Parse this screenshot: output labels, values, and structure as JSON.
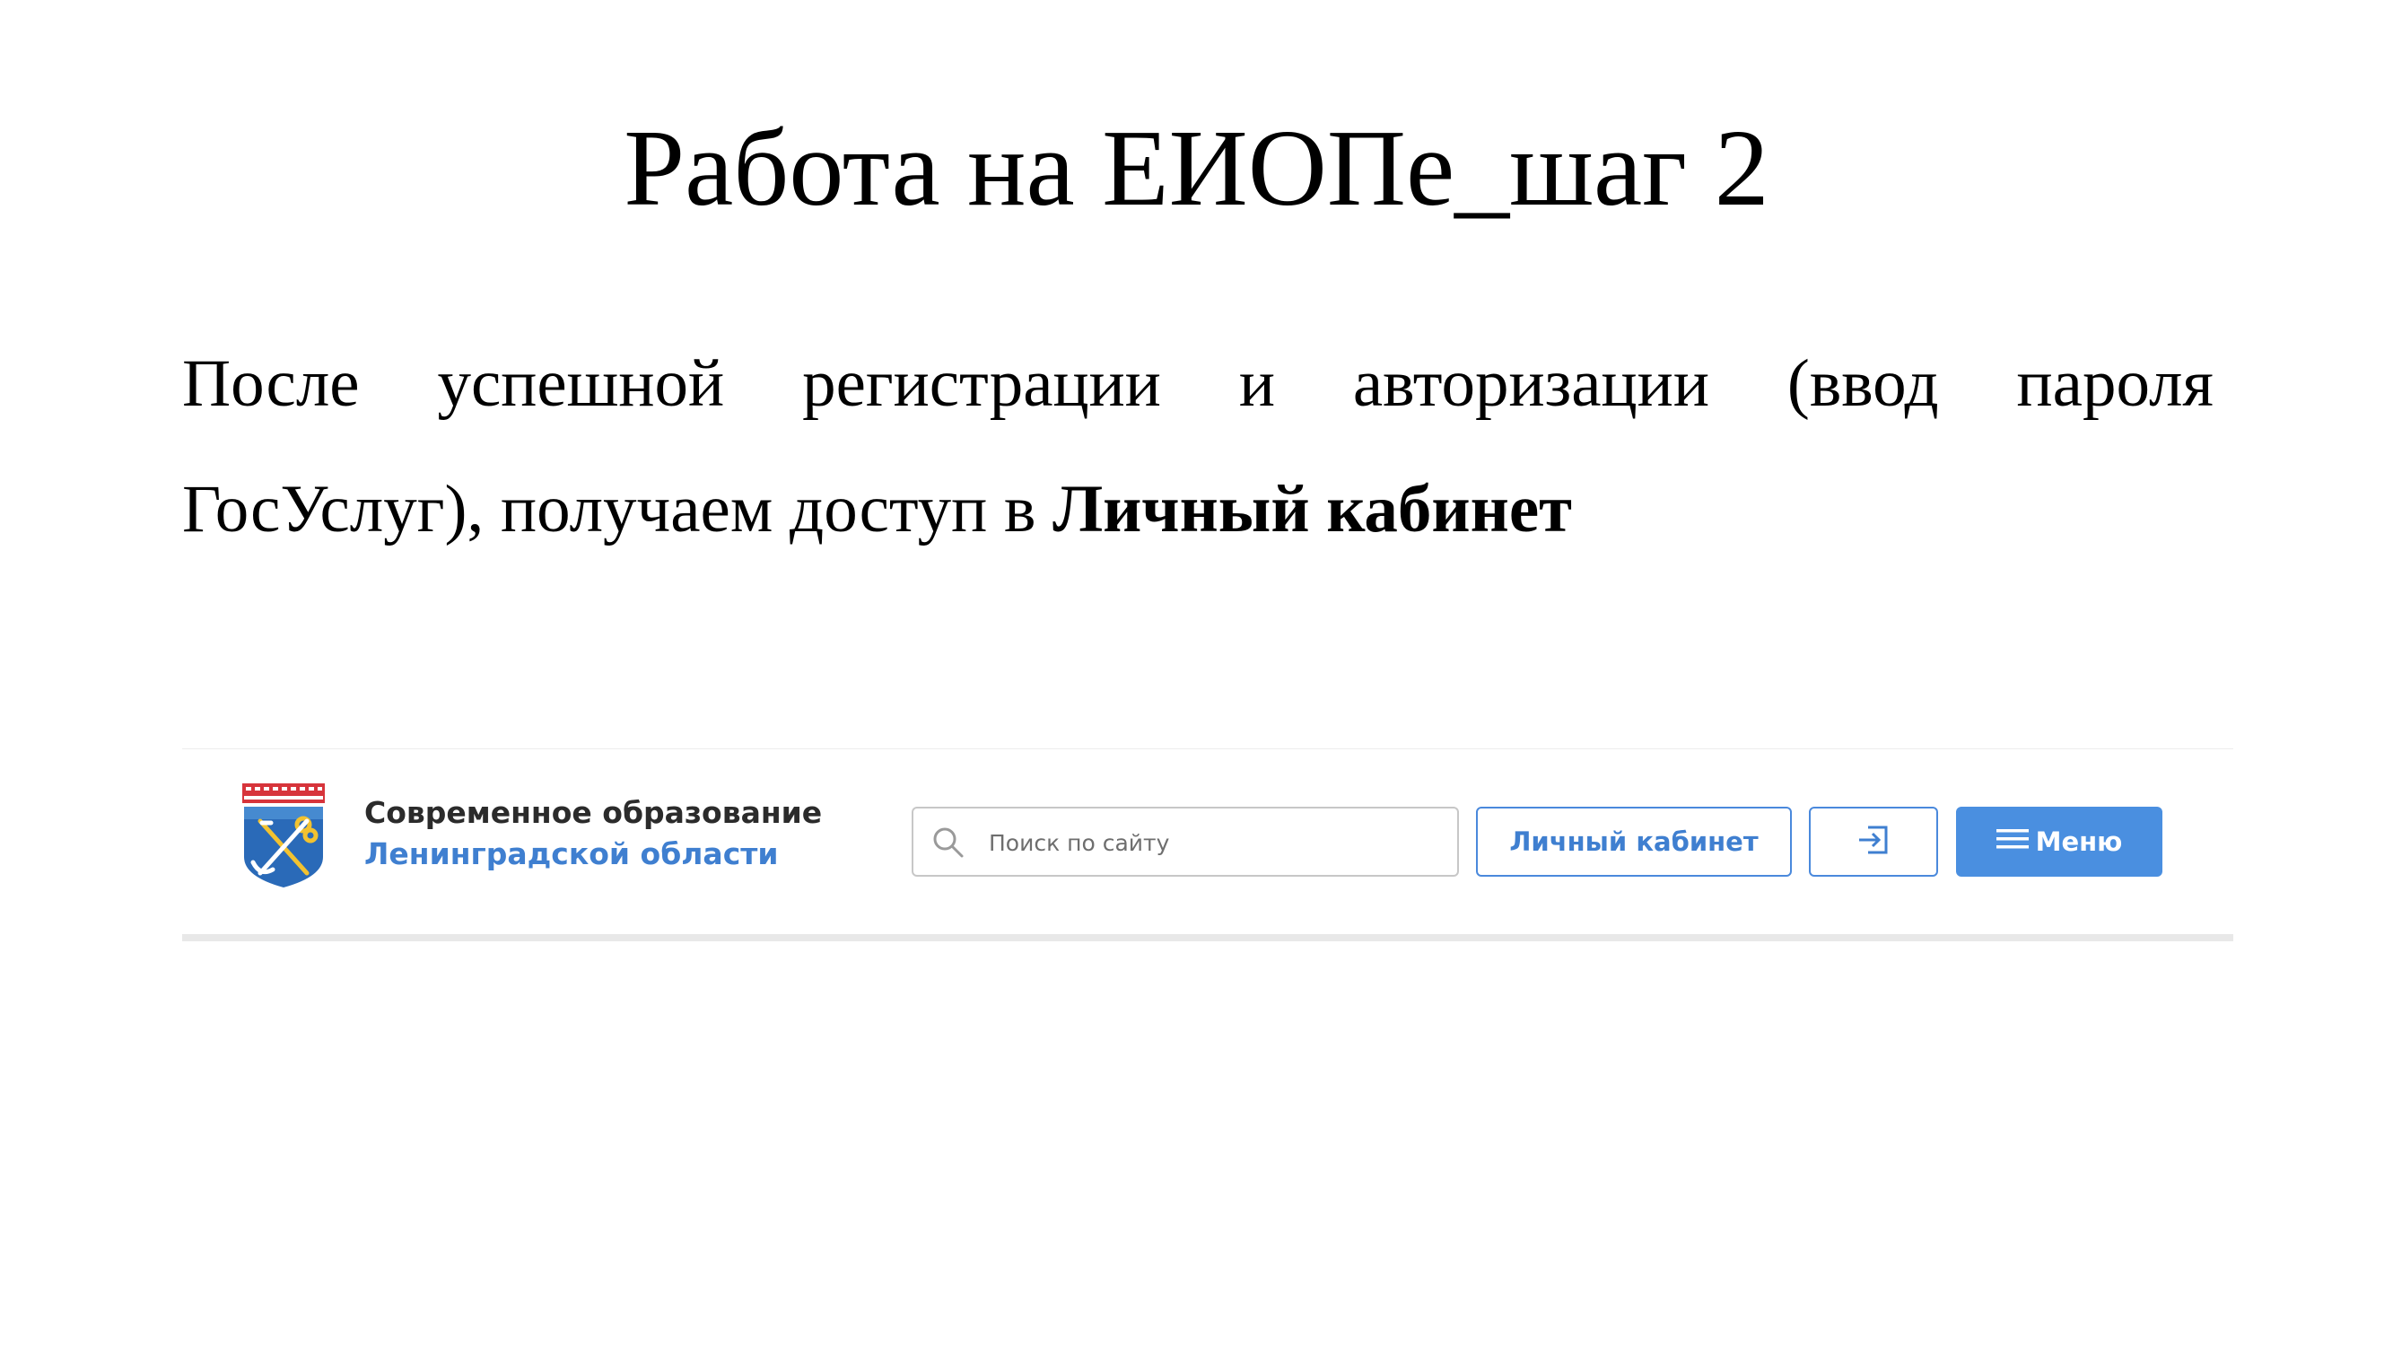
{
  "slide": {
    "title": "Работа на ЕИОПе_шаг 2",
    "paragraph": {
      "line1_words": [
        "После",
        "успешной",
        "регистрации",
        "и",
        "авторизации",
        "(ввод",
        "пароля"
      ],
      "line2_text": "ГосУслуг), получаем доступ в ",
      "line2_bold": "Личный кабинет"
    }
  },
  "site_header": {
    "brand": {
      "line1": "Современное образование",
      "line2": "Ленинградской области"
    },
    "search": {
      "placeholder": "Поиск по сайту",
      "value": ""
    },
    "cabinet_label": "Личный кабинет",
    "menu_label": "Меню",
    "icons": {
      "logo": "coat-of-arms-icon",
      "search": "search-icon",
      "login": "login-icon",
      "menu": "hamburger-icon"
    },
    "colors": {
      "brand_blue": "#3f7fd0",
      "menu_bg": "#4a8fe0",
      "brand_dark": "#2b2b2b"
    }
  }
}
